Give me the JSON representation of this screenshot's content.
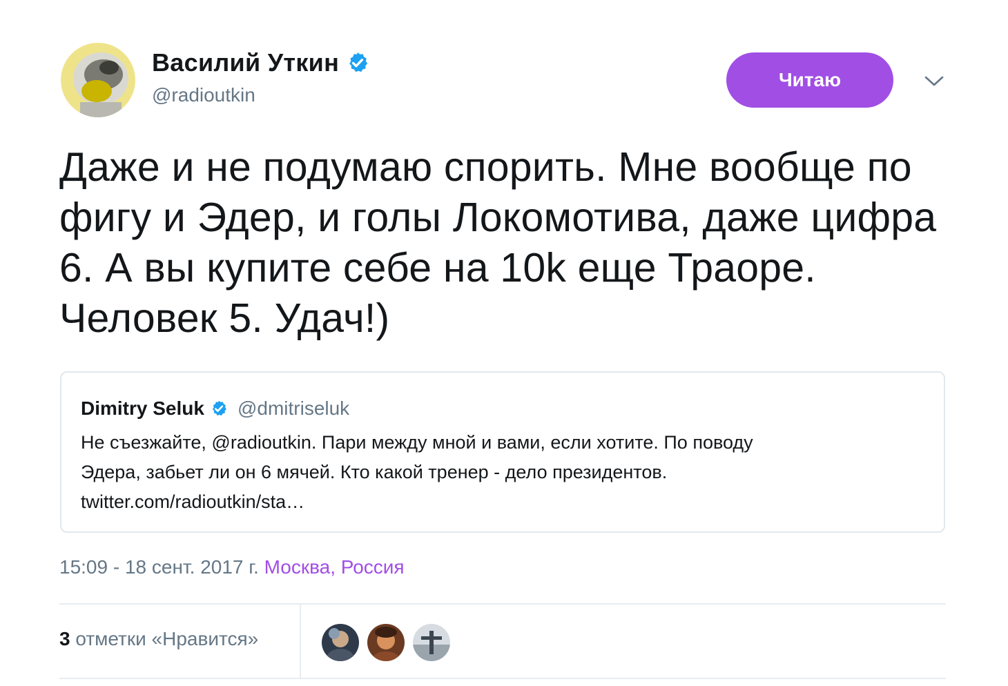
{
  "author": {
    "display_name": "Василий Уткин",
    "handle": "@radioutkin",
    "avatar_icon": "user-avatar-icon",
    "verified_icon": "verified-badge-icon"
  },
  "actions": {
    "follow_label": "Читаю",
    "more_icon": "chevron-down-icon"
  },
  "tweet": {
    "text": "Даже и не подумаю спорить. Мне вообще по фигу и Эдер, и голы Локомотива, даже цифра 6. А вы купите себе на 10k еще Траоре. Человек 5. Удач!)"
  },
  "quoted_tweet": {
    "display_name": "Dimitry Seluk",
    "handle": "@dmitriseluk",
    "text_line1": "Не съезжайте, @radioutkin. Пари между мной и вами, если хотите. По поводу",
    "text_line2": "Эдера, забьет ли он 6 мячей. Кто какой тренер - дело президентов.",
    "text_line3": "twitter.com/radioutkin/sta…"
  },
  "meta": {
    "timestamp": "15:09 - 18 сент. 2017 г.",
    "location": "Москва, Россия"
  },
  "stats": {
    "likes_count": "3",
    "likes_label": "отметки «Нравится»",
    "liker_icons": [
      "liker-avatar-icon",
      "liker-avatar-icon",
      "liker-avatar-icon"
    ]
  },
  "colors": {
    "accent": "#a14ee5",
    "verified": "#1da1f2",
    "secondary_text": "#657786",
    "border": "#e1e8ed"
  }
}
